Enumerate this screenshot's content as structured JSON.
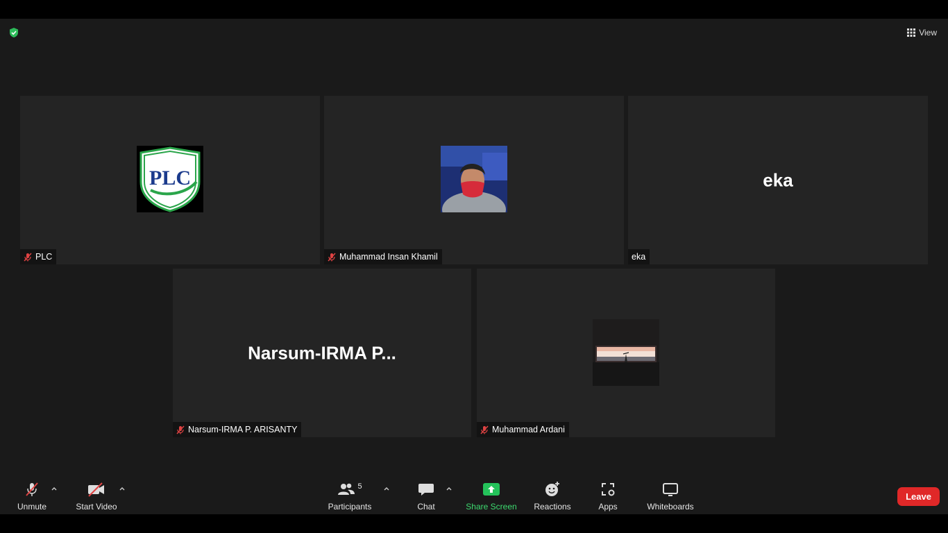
{
  "header": {
    "view_label": "View"
  },
  "participants": [
    {
      "display_name": "PLC",
      "avatar_text": "PLC"
    },
    {
      "display_name": "Muhammad Insan Khamil"
    },
    {
      "display_name": "eka",
      "big_name": "eka"
    },
    {
      "display_name": "Narsum-IRMA P. ARISANTY",
      "big_name": "Narsum-IRMA P..."
    },
    {
      "display_name": "Muhammad Ardani"
    }
  ],
  "toolbar": {
    "unmute_label": "Unmute",
    "start_video_label": "Start Video",
    "participants_label": "Participants",
    "participants_count": "5",
    "chat_label": "Chat",
    "share_screen_label": "Share Screen",
    "reactions_label": "Reactions",
    "apps_label": "Apps",
    "whiteboards_label": "Whiteboards",
    "leave_label": "Leave"
  },
  "colors": {
    "background": "#1a1a1a",
    "tile": "#242424",
    "share_green": "#24c25a",
    "leave_red": "#e02828",
    "muted_red": "#e04343",
    "shield_green": "#2dbb5a"
  }
}
